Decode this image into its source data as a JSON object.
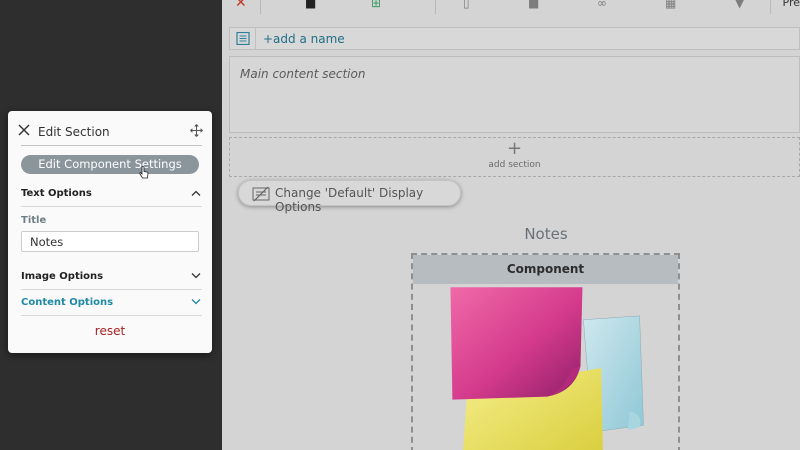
{
  "toolbar": {
    "icons": [
      "close-icon",
      "lock-icon",
      "add-icon",
      "document-icon",
      "camera-icon",
      "link-icon",
      "grid-icon",
      "location-icon"
    ],
    "preview_label": "Pre"
  },
  "name_row": {
    "link_text": "+add a name"
  },
  "main_section": {
    "placeholder": "Main content section"
  },
  "add_section": {
    "plus": "+",
    "label": "add section"
  },
  "display_options_button": {
    "label": "Change 'Default' Display Options"
  },
  "notes_component": {
    "title": "Notes",
    "header": "Component"
  },
  "edit_panel": {
    "title": "Edit Section",
    "settings_button": "Edit Component Settings",
    "text_options": "Text Options",
    "title_field_label": "Title",
    "title_field_value": "Notes",
    "image_options": "Image Options",
    "content_options": "Content Options",
    "reset": "reset"
  },
  "colors": {
    "accent_teal": "#1f8aa6",
    "reset_red": "#a71f20",
    "button_gray": "#8b969c"
  }
}
